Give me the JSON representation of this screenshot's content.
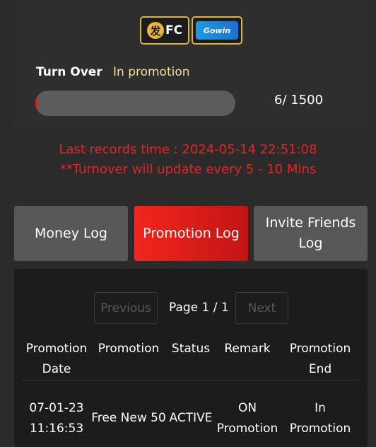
{
  "logos": {
    "fc_glyph": "发",
    "fc_text": "FC",
    "gw_text": "Gowin"
  },
  "turnover": {
    "label": "Turn Over",
    "status": "In promotion",
    "progress_current": 6,
    "progress_target": 1500,
    "progress_text": "6/ 1500"
  },
  "notice": {
    "last_records": "Last records time : 2024-05-14 22:51:08",
    "update_note": "**Turnover will update every 5 - 10 Mins"
  },
  "tabs": [
    {
      "label": "Money Log",
      "active": false
    },
    {
      "label": "Promotion Log",
      "active": true
    },
    {
      "label": "Invite Friends Log",
      "active": false
    }
  ],
  "pagination": {
    "previous": "Previous",
    "page": "Page 1 / 1",
    "next": "Next"
  },
  "table": {
    "headers": [
      "Promotion Date",
      "Promotion",
      "Status",
      "Remark",
      "Promotion End"
    ],
    "rows": [
      [
        "07-01-23 11:16:53",
        "Free New 50",
        "ACTIVE",
        "ON Promotion",
        "In Promotion"
      ]
    ]
  },
  "colors": {
    "accent_red": "#e42525",
    "active_tab": "#f2261b",
    "status_yellow": "#efe09a"
  }
}
